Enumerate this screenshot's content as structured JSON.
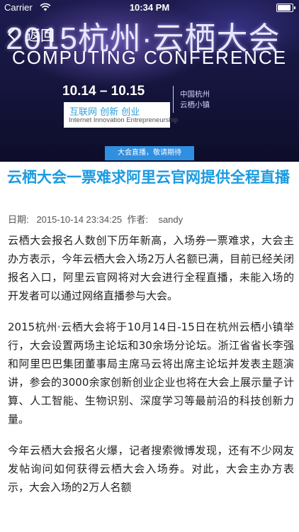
{
  "status_bar": {
    "carrier": "Carrier",
    "time": "10:34 PM",
    "battery_level": 1.0
  },
  "nav": {
    "back_label": "返回"
  },
  "banner": {
    "event_title": "2015杭州·云栖大会",
    "subtitle": "COMPUTING CONFERENCE",
    "dates": "10.14 – 10.15",
    "location_line1": "中国杭州",
    "location_line2": "云栖小镇",
    "slogan_cn": "互联网  创新  创业",
    "slogan_en": "Internet  Innovation  Entrepreneurship",
    "live_tag": "大会直播，敬请期待"
  },
  "article": {
    "title": "云栖大会一票难求阿里云官网提供全程直播",
    "meta": "日期:   2015-10-14 23:34:25  作者:    sandy",
    "paragraphs": [
      "云栖大会报名人数创下历年新高，入场券一票难求，大会主办方表示，今年云栖大会入场2万人名额已满，目前已经关闭报名入口，阿里云官网将对大会进行全程直播，未能入场的开发者可以通过网络直播参与大会。",
      "2015杭州·云栖大会将于10月14日-15日在杭州云栖小镇举行，大会设置两场主论坛和30余场分论坛。浙江省省长李强和阿里巴巴集团董事局主席马云将出席主论坛并发表主题演讲，参会的3000余家创新创业企业也将在大会上展示量子计算、人工智能、生物识别、深度学习等最前沿的科技创新力量。",
      "今年云栖大会报名火爆，记者搜索微博发现，还有不少网友发帖询问如何获得云栖大会入场券。对此，大会主办方表示，大会入场的2万人名额"
    ]
  }
}
